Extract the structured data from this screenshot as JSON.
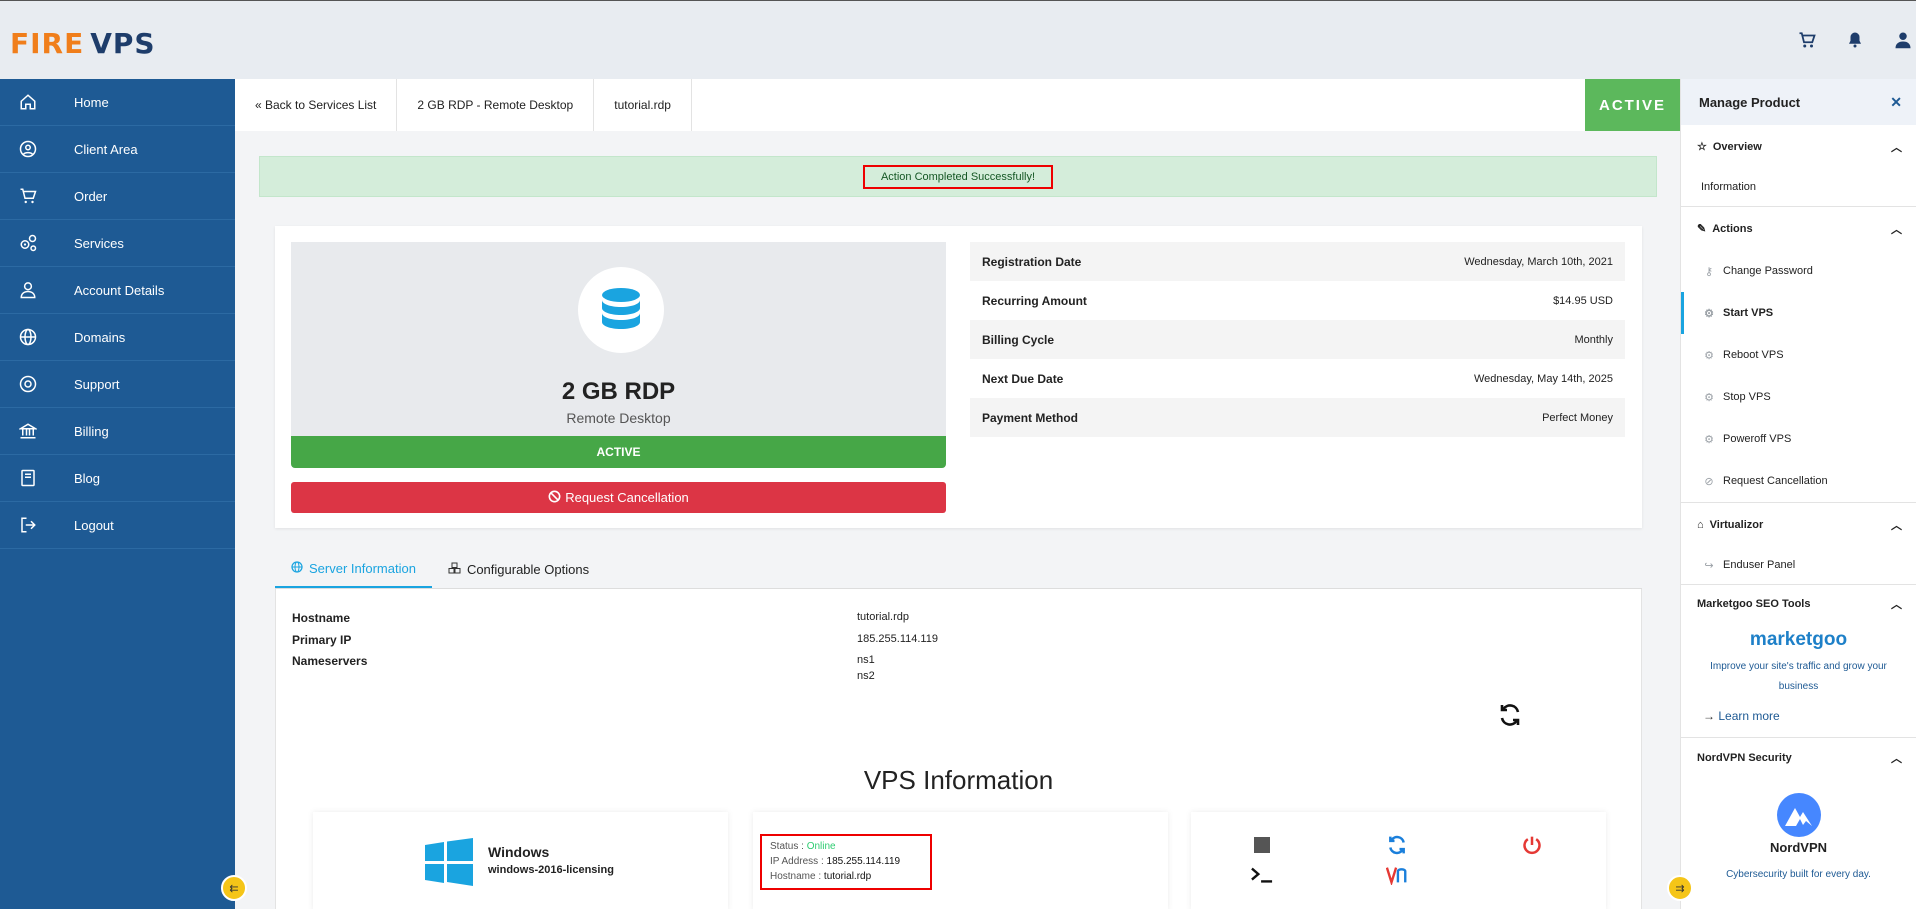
{
  "brand": {
    "logo_fire": "FIRE",
    "logo_vps": "VPS"
  },
  "header": {
    "icons": [
      "cart-icon",
      "bell-icon",
      "user-icon"
    ]
  },
  "sidebar": {
    "items": [
      {
        "label": "Home",
        "icon": "home-icon"
      },
      {
        "label": "Client Area",
        "icon": "user-circle-icon"
      },
      {
        "label": "Order",
        "icon": "cart-icon"
      },
      {
        "label": "Services",
        "icon": "gears-icon"
      },
      {
        "label": "Account Details",
        "icon": "user-icon"
      },
      {
        "label": "Domains",
        "icon": "globe-icon"
      },
      {
        "label": "Support",
        "icon": "lifebuoy-icon"
      },
      {
        "label": "Billing",
        "icon": "bank-icon"
      },
      {
        "label": "Blog",
        "icon": "book-icon"
      },
      {
        "label": "Logout",
        "icon": "logout-icon"
      }
    ]
  },
  "breadcrumb": {
    "back": "« Back to Services List",
    "product": "2 GB RDP - Remote Desktop",
    "hostname": "tutorial.rdp",
    "status": "ACTIVE"
  },
  "alert": {
    "message": "Action Completed Successfully!"
  },
  "product": {
    "name": "2 GB RDP",
    "subtitle": "Remote Desktop",
    "status": "ACTIVE",
    "cancel_label": "Request Cancellation"
  },
  "billing": [
    {
      "key": "Registration Date",
      "value": "Wednesday, March 10th, 2021"
    },
    {
      "key": "Recurring Amount",
      "value": "$14.95 USD"
    },
    {
      "key": "Billing Cycle",
      "value": "Monthly"
    },
    {
      "key": "Next Due Date",
      "value": "Wednesday, May 14th, 2025"
    },
    {
      "key": "Payment Method",
      "value": "Perfect Money"
    }
  ],
  "tabs": [
    {
      "label": "Server Information",
      "active": true
    },
    {
      "label": "Configurable Options",
      "active": false
    }
  ],
  "server": {
    "hostname_label": "Hostname",
    "hostname": "tutorial.rdp",
    "ip_label": "Primary IP",
    "ip": "185.255.114.119",
    "ns_label": "Nameservers",
    "ns1": "ns1",
    "ns2": "ns2"
  },
  "vps": {
    "title": "VPS Information",
    "os_name": "Windows",
    "os_template": "windows-2016-licensing",
    "status_label": "Status :",
    "status_value": "Online",
    "ip_label": "IP Address :",
    "ip_value": "185.255.114.119",
    "host_label": "Hostname :",
    "host_value": "tutorial.rdp"
  },
  "right_panel": {
    "title": "Manage Product",
    "overview": {
      "title": "Overview",
      "items": [
        "Information"
      ]
    },
    "actions": {
      "title": "Actions",
      "items": [
        "Change Password",
        "Start VPS",
        "Reboot VPS",
        "Stop VPS",
        "Poweroff VPS",
        "Request Cancellation"
      ],
      "active": "Start VPS"
    },
    "virtualizor": {
      "title": "Virtualizor",
      "items": [
        "Enduser Panel"
      ]
    },
    "marketgoo": {
      "title": "Marketgoo SEO Tools",
      "logo": "marketgoo",
      "text": "Improve your site's traffic and grow your business",
      "link": "Learn more"
    },
    "nordvpn": {
      "title": "NordVPN Security",
      "logo": "NordVPN",
      "text": "Cybersecurity built for every day."
    }
  },
  "colors": {
    "sidebar": "#1e5a94",
    "active_green": "#5cb85c",
    "danger": "#dc3545",
    "accent": "#1aa4e0"
  }
}
